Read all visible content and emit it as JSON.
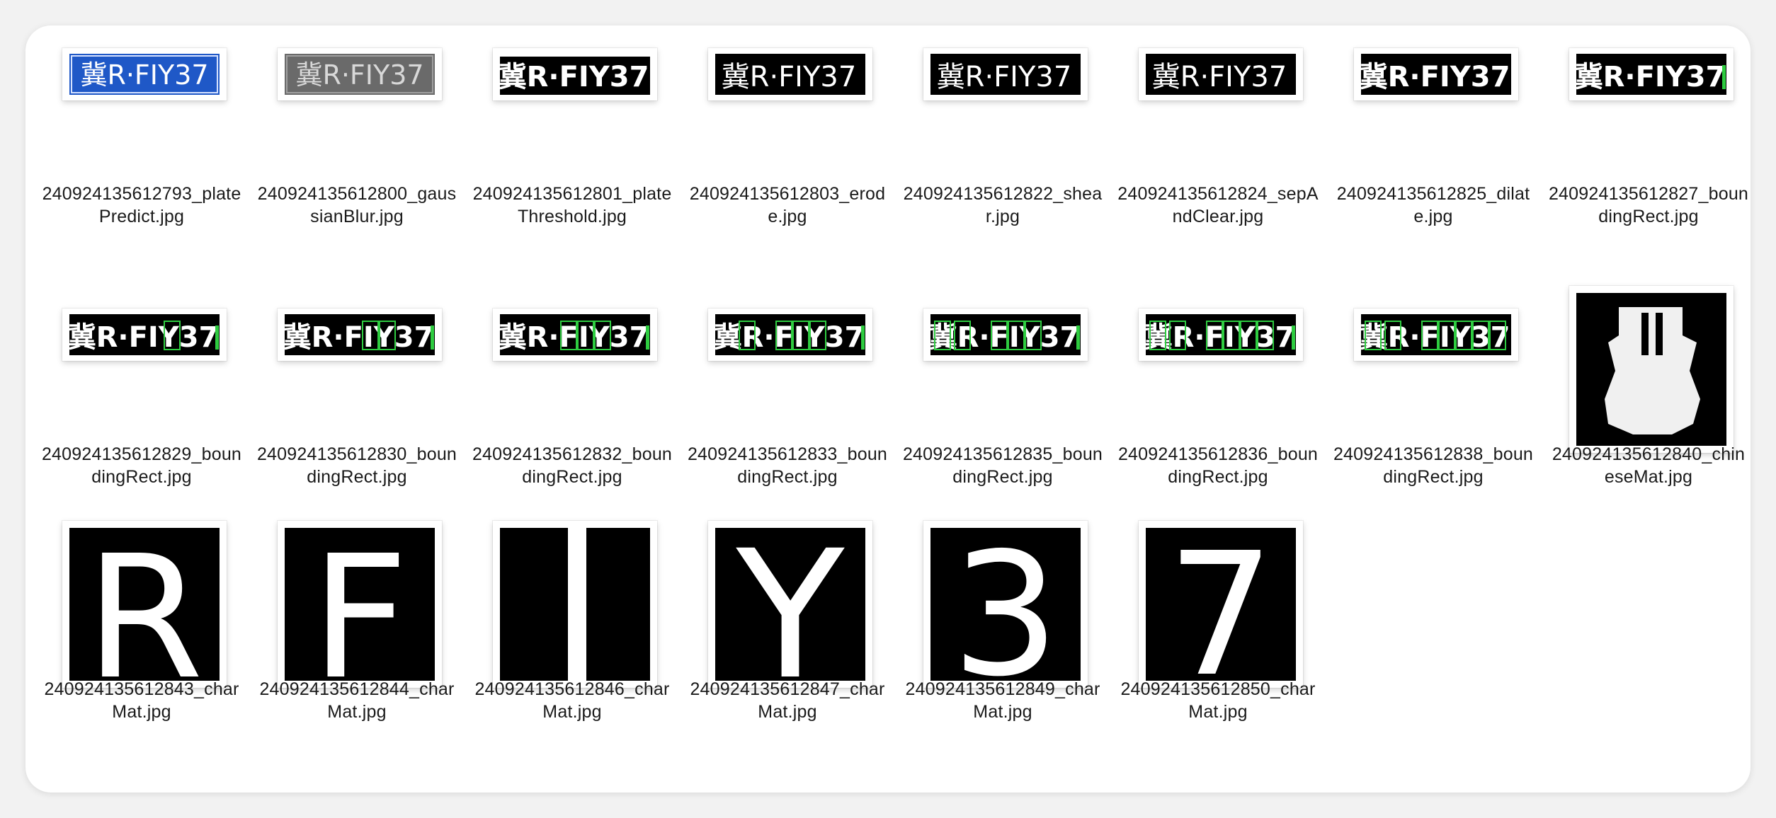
{
  "window": {
    "title": ""
  },
  "files": [
    {
      "name": "240924135612793_platePredict.jpg",
      "line1": "240924135612793_plate",
      "line2": "Predict.jpg",
      "thumbnail": "plate-color-icon"
    },
    {
      "name": "240924135612800_gaussianBlur.jpg",
      "line1": "240924135612800_gaus",
      "line2": "sianBlur.jpg",
      "thumbnail": "plate-gray-icon"
    },
    {
      "name": "240924135612801_plateThreshold.jpg",
      "line1": "240924135612801_plate",
      "line2": "Threshold.jpg",
      "thumbnail": "plate-binary-icon"
    },
    {
      "name": "240924135612803_erode.jpg",
      "line1": "240924135612803_erod",
      "line2": "e.jpg",
      "thumbnail": "plate-binary-icon"
    },
    {
      "name": "240924135612822_shear.jpg",
      "line1": "240924135612822_shea",
      "line2": "r.jpg",
      "thumbnail": "plate-binary-icon"
    },
    {
      "name": "240924135612824_sepAndClear.jpg",
      "line1": "240924135612824_sepA",
      "line2": "ndClear.jpg",
      "thumbnail": "plate-binary-icon"
    },
    {
      "name": "240924135612825_dilate.jpg",
      "line1": "240924135612825_dilat",
      "line2": "e.jpg",
      "thumbnail": "plate-binary-icon"
    },
    {
      "name": "240924135612827_boundingRect.jpg",
      "line1": "240924135612827_boun",
      "line2": "dingRect.jpg",
      "thumbnail": "plate-rect-icon"
    },
    {
      "name": "240924135612829_boundingRect.jpg",
      "line1": "240924135612829_boun",
      "line2": "dingRect.jpg",
      "thumbnail": "plate-rect-icon"
    },
    {
      "name": "240924135612830_boundingRect.jpg",
      "line1": "240924135612830_boun",
      "line2": "dingRect.jpg",
      "thumbnail": "plate-rect-icon"
    },
    {
      "name": "240924135612832_boundingRect.jpg",
      "line1": "240924135612832_boun",
      "line2": "dingRect.jpg",
      "thumbnail": "plate-rect-icon"
    },
    {
      "name": "240924135612833_boundingRect.jpg",
      "line1": "240924135612833_boun",
      "line2": "dingRect.jpg",
      "thumbnail": "plate-rect-icon"
    },
    {
      "name": "240924135612835_boundingRect.jpg",
      "line1": "240924135612835_boun",
      "line2": "dingRect.jpg",
      "thumbnail": "plate-rect-icon"
    },
    {
      "name": "240924135612836_boundingRect.jpg",
      "line1": "240924135612836_boun",
      "line2": "dingRect.jpg",
      "thumbnail": "plate-rect-icon"
    },
    {
      "name": "240924135612838_boundingRect.jpg",
      "line1": "240924135612838_boun",
      "line2": "dingRect.jpg",
      "thumbnail": "plate-rect-icon"
    },
    {
      "name": "240924135612840_chineseMat.jpg",
      "line1": "240924135612840_chin",
      "line2": "eseMat.jpg",
      "thumbnail": "char-chinese-icon"
    },
    {
      "name": "240924135612843_charMat.jpg",
      "line1": "240924135612843_char",
      "line2": "Mat.jpg",
      "thumbnail": "char-r-icon"
    },
    {
      "name": "240924135612844_charMat.jpg",
      "line1": "240924135612844_char",
      "line2": "Mat.jpg",
      "thumbnail": "char-f-icon"
    },
    {
      "name": "240924135612846_charMat.jpg",
      "line1": "240924135612846_char",
      "line2": "Mat.jpg",
      "thumbnail": "char-i-icon"
    },
    {
      "name": "240924135612847_charMat.jpg",
      "line1": "240924135612847_char",
      "line2": "Mat.jpg",
      "thumbnail": "char-y-icon"
    },
    {
      "name": "240924135612849_charMat.jpg",
      "line1": "240924135612849_char",
      "line2": "Mat.jpg",
      "thumbnail": "char-3-icon"
    },
    {
      "name": "240924135612850_charMat.jpg",
      "line1": "240924135612850_char",
      "line2": "Mat.jpg",
      "thumbnail": "char-7-icon"
    }
  ],
  "plate_text": "冀R·FIY37",
  "colors": {
    "plate_blue": "#1f58c7",
    "rect_green": "#2ecc40",
    "panel": "#ffffff",
    "text": "#1a1a1a"
  }
}
